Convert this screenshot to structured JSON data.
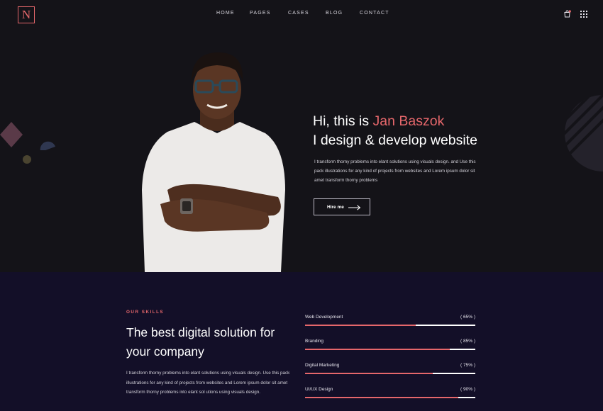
{
  "brand": {
    "logo_letter": "N"
  },
  "nav": [
    "HOME",
    "PAGES",
    "CASES",
    "BLOG",
    "CONTACT"
  ],
  "header_icons": [
    "shopping-bag-icon",
    "menu-grid-icon"
  ],
  "hero": {
    "greeting": "Hi, this is ",
    "name": "Jan Baszok",
    "subtitle": "I design & develop website",
    "description": "I transform thorny problems into elant solutions using visuals design. and Use this pack illustrations for any kind of projects from websites and Lorem ipsum dolor sit amet transform thorny problems",
    "cta_label": "Hire me"
  },
  "skills": {
    "tag": "OUR SKILLS",
    "heading": "The best digital solution for your company",
    "description": "I transform thorny problems into elant solutions using visuals design. Use this pack illustrations for any kind of projects from websites and Lorem ipsum dolor sit amet transform thorny problems into elant sol utions using visuals design.",
    "items": [
      {
        "name": "Web Development",
        "value_label": "( 65% )",
        "percent": 65
      },
      {
        "name": "Branding",
        "value_label": "( 85% )",
        "percent": 85
      },
      {
        "name": "Digital Marketing",
        "value_label": "( 75% )",
        "percent": 75
      },
      {
        "name": "UI/UX Design",
        "value_label": "( 90% )",
        "percent": 90
      }
    ]
  },
  "colors": {
    "accent": "#e5676b",
    "hero_bg": "#141318",
    "skills_bg": "#130f28",
    "track": "#ffffff"
  }
}
